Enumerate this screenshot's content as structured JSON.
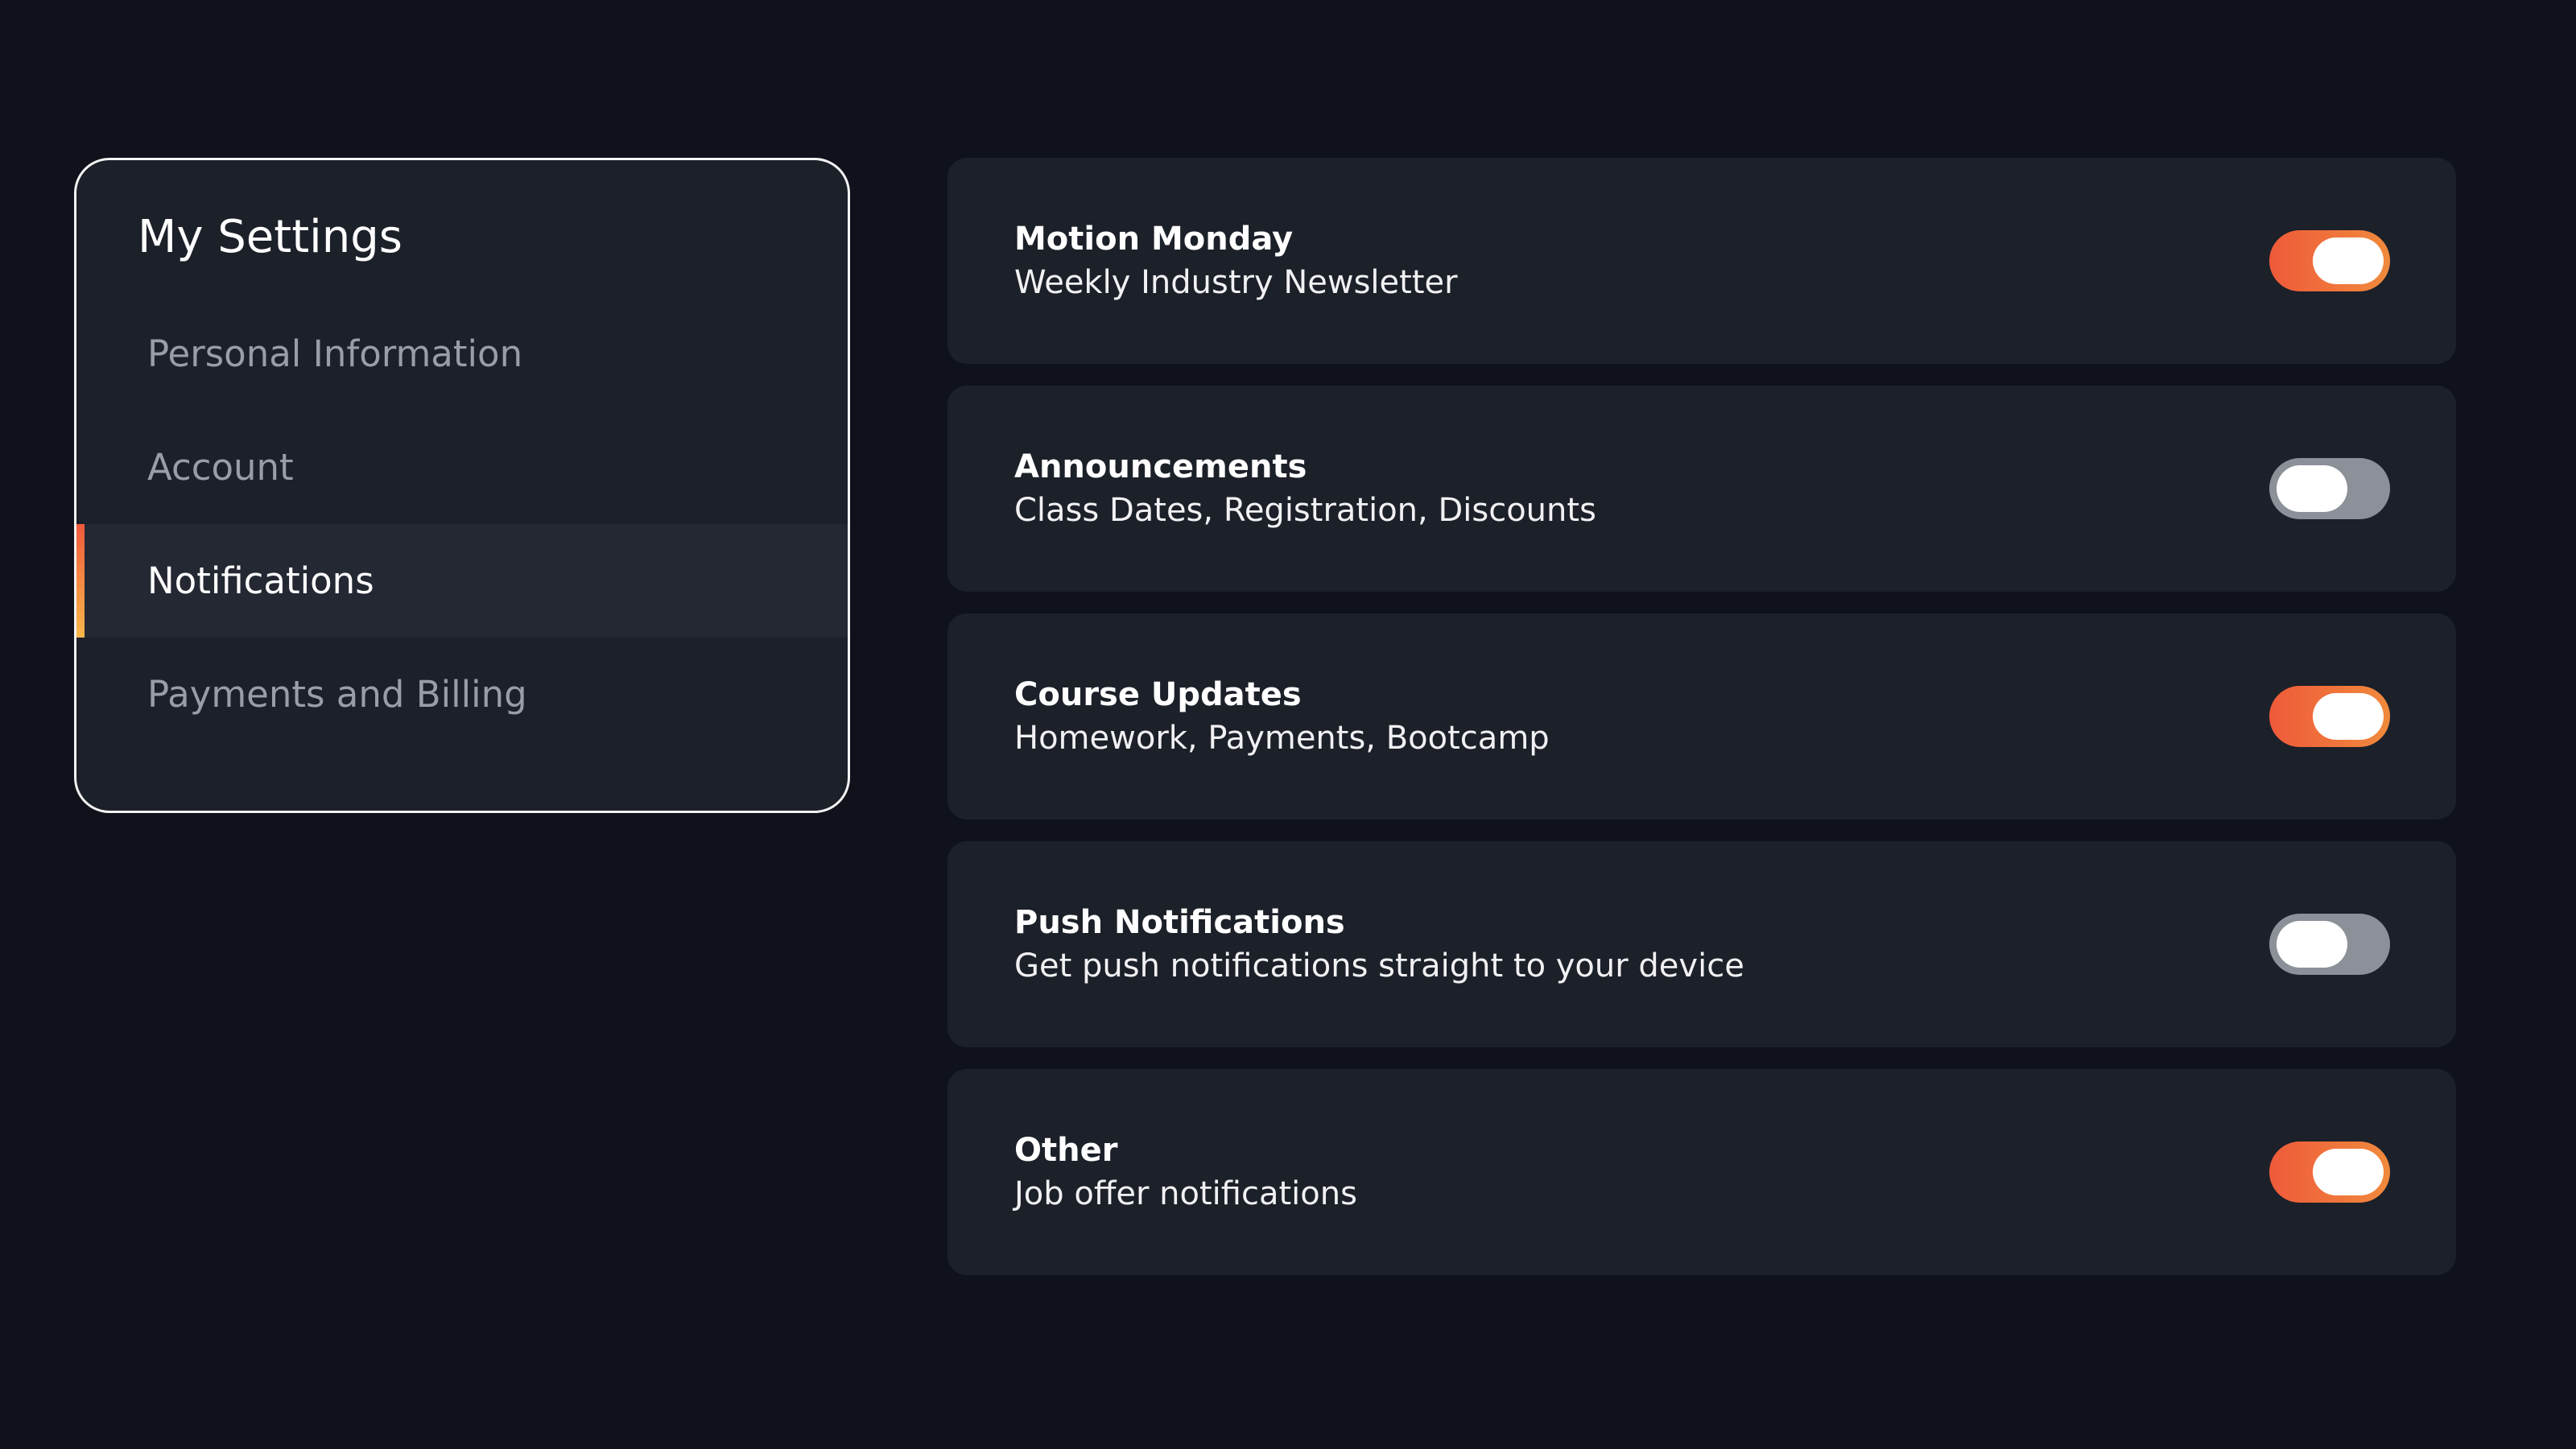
{
  "sidebar": {
    "title": "My Settings",
    "items": [
      {
        "label": "Personal Information",
        "active": false
      },
      {
        "label": "Account",
        "active": false
      },
      {
        "label": "Notifications",
        "active": true
      },
      {
        "label": "Payments and Billing",
        "active": false
      }
    ],
    "accent_gradient": [
      "#f05a3c",
      "#f7b84b"
    ]
  },
  "notifications": [
    {
      "title": "Motion Monday",
      "subtitle": "Weekly Industry Newsletter",
      "enabled": true
    },
    {
      "title": "Announcements",
      "subtitle": "Class Dates, Registration, Discounts",
      "enabled": false
    },
    {
      "title": "Course Updates",
      "subtitle": "Homework, Payments, Bootcamp",
      "enabled": true
    },
    {
      "title": "Push Notifications",
      "subtitle": "Get push notifications straight to your device",
      "enabled": false
    },
    {
      "title": "Other",
      "subtitle": "Job offer notifications",
      "enabled": true
    }
  ],
  "colors": {
    "background": "#0f121a",
    "card": "#1c2029",
    "active_item": "#242833",
    "toggle_on": "#ef5a3a",
    "toggle_off": "#8b9099"
  }
}
